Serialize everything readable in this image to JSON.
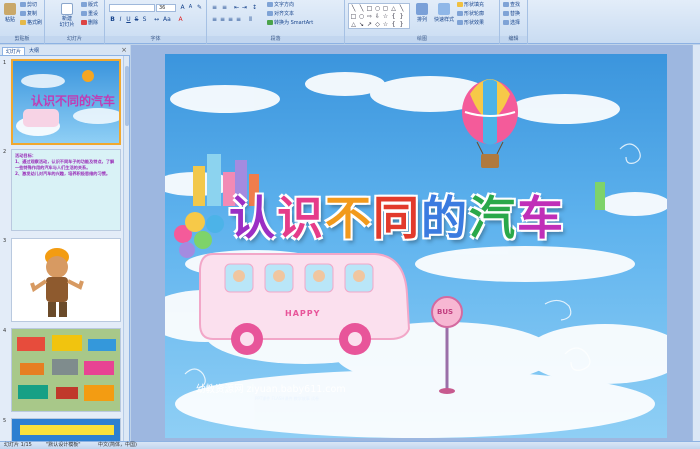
{
  "ribbon": {
    "clipboard": {
      "label": "剪贴板",
      "paste": "粘贴",
      "cut": "剪切",
      "copy": "复制",
      "format_painter": "格式刷"
    },
    "slides": {
      "label": "幻灯片",
      "new_slide": "新建\n幻灯片",
      "layout": "版式",
      "reset": "重设",
      "delete": "删除"
    },
    "font": {
      "label": "字体",
      "font_name": "",
      "font_size": "36"
    },
    "paragraph": {
      "label": "段落",
      "text_direction": "文字方向",
      "align_text": "对齐文本",
      "smartart": "转换为 SmartArt"
    },
    "drawing": {
      "label": "绘图",
      "arrange": "排列",
      "quick_styles": "快速样式",
      "shape_fill": "形状填充",
      "shape_outline": "形状轮廓",
      "shape_effects": "形状效果"
    },
    "editing": {
      "label": "编辑",
      "find": "查找",
      "replace": "替换",
      "select": "选择"
    }
  },
  "left_panel": {
    "tab_slides": "幻灯片",
    "tab_outline": "大纲",
    "close": "×",
    "slide_numbers": [
      "1",
      "2",
      "3",
      "4",
      "5"
    ],
    "slide2_text": "活动目标：\n1、通过观察活动，认识不同车子的功能及特点，了解一些特殊作用的汽车与人们生活的关系。\n2、激发幼儿对汽车的兴趣，培养积极思维的习惯。"
  },
  "slide": {
    "title_chars": [
      "认",
      "识",
      "不",
      "同",
      "的",
      "汽",
      "车"
    ],
    "title_colors": [
      "#9b2fc4",
      "#e53c8a",
      "#f29a1c",
      "#e23a2c",
      "#3b7be0",
      "#2aa84a",
      "#c02fb8"
    ],
    "site_text": "幼教资源网 ziyuan.baby611.com",
    "sub_text": "PPT课件  FLASH课件  教学故事  试卷",
    "bus_label": "HAPPY",
    "sign_label": "BUS"
  },
  "status_bar": {
    "slide_info": "幻灯片 1/15",
    "theme": "\"默认设计模板\"",
    "language": "中文(简体，中国)"
  }
}
